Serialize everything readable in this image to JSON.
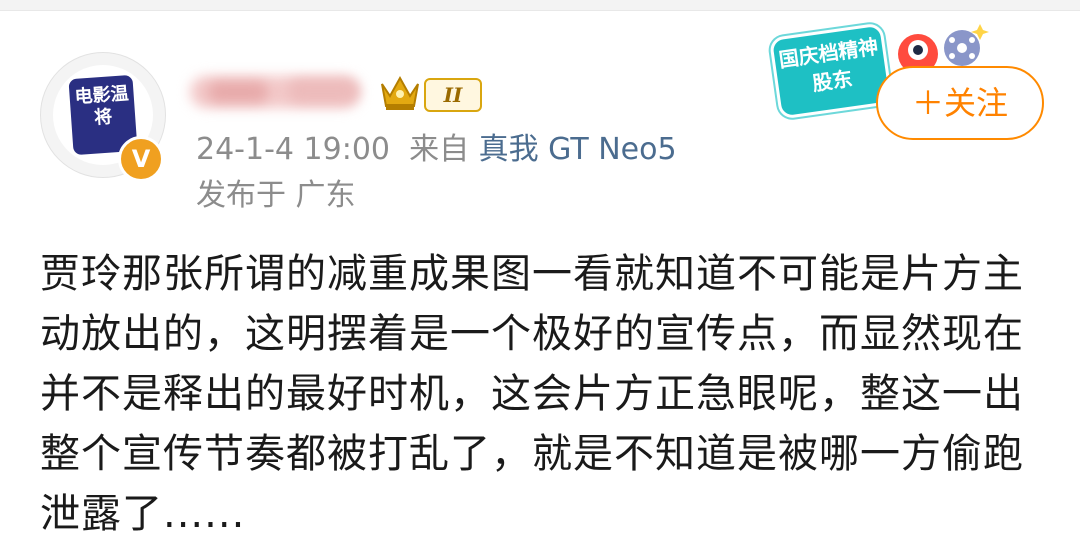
{
  "post": {
    "avatar": {
      "logo_text": "电影温将",
      "verified_mark": "V"
    },
    "user": {
      "level_badge": "II"
    },
    "meta": {
      "timestamp": "24-1-4 19:00",
      "source_prefix": "来自",
      "device": "真我 GT Neo5"
    },
    "location": "发布于 广东",
    "sticker": {
      "text": "国庆档精神股东"
    },
    "follow_button": {
      "label": "＋关注"
    },
    "content": "贾玲那张所谓的减重成果图一看就知道不可能是片方主动放出的，这明摆着是一个极好的宣传点，而显然现在并不是释出的最好时机，这会片方正急眼呢，整这一出整个宣传节奏都被打乱了，就是不知道是被哪一方偷跑泄露了......"
  },
  "colors": {
    "accent": "#ff8200",
    "meta": "#8c8c8c",
    "device": "#4b6c8f"
  }
}
